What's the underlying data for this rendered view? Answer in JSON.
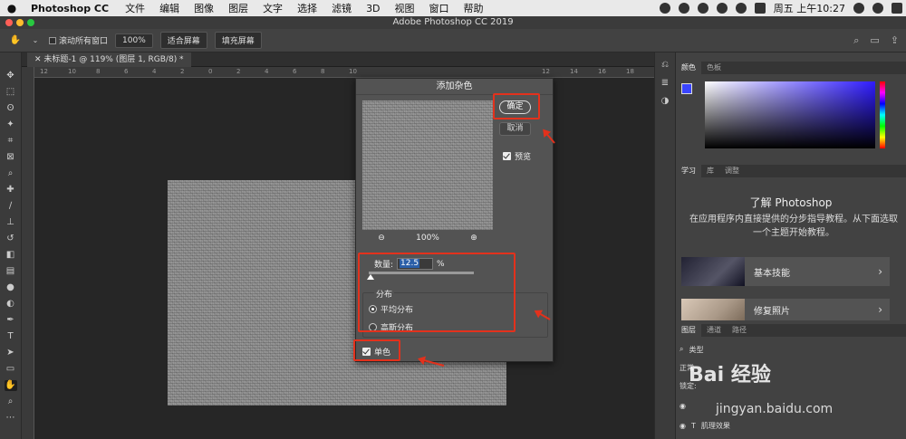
{
  "menubar": {
    "app": "Photoshop CC",
    "items": [
      "文件",
      "编辑",
      "图像",
      "图层",
      "文字",
      "选择",
      "滤镜",
      "3D",
      "视图",
      "窗口",
      "帮助"
    ],
    "clock": "周五 上午10:27"
  },
  "window": {
    "title": "Adobe Photoshop CC 2019"
  },
  "options": {
    "scroll_all": "滚动所有窗口",
    "zoom_100": "100%",
    "fit_screen": "适合屏幕",
    "fill_screen": "填充屏幕"
  },
  "document_tab": "未标题-1 @ 119% (图层 1, RGB/8) *",
  "ruler_ticks": [
    "12",
    "10",
    "8",
    "6",
    "4",
    "2",
    "0",
    "2",
    "4",
    "6",
    "8",
    "10",
    "12",
    "14",
    "16",
    "18"
  ],
  "dialog": {
    "title": "添加杂色",
    "ok": "确定",
    "cancel": "取消",
    "preview": "预览",
    "zoom": "100%",
    "amount_label": "数量:",
    "amount_value": "12.5",
    "amount_unit": "%",
    "distribution_label": "分布",
    "uniform": "平均分布",
    "gaussian": "高斯分布",
    "monochromatic": "单色"
  },
  "panels": {
    "color_tabs": [
      "颜色",
      "色板"
    ],
    "learn_tabs": [
      "学习",
      "库",
      "调整"
    ],
    "learn_title": "了解 Photoshop",
    "learn_desc": "在应用程序内直接提供的分步指导教程。从下面选取一个主题开始教程。",
    "lesson1": "基本技能",
    "lesson2": "修复照片",
    "layer_tabs": [
      "图层",
      "通道",
      "路径"
    ],
    "layer_kind": "类型",
    "blend_mode": "正常",
    "lock_label": "锁定:",
    "layer_text": "肌理效果"
  },
  "watermark": {
    "logo": "Bai 经验",
    "url": "jingyan.baidu.com"
  },
  "colors": {
    "accent_red": "#e3311c",
    "fg_swatch": "#3a45ff"
  }
}
